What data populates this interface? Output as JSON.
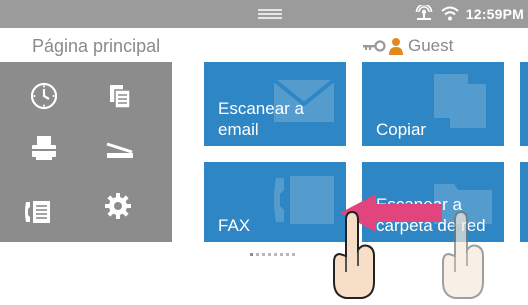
{
  "status_bar": {
    "time": "12:59PM",
    "icons": [
      "network-icon",
      "wifi-icon"
    ]
  },
  "header": {
    "page_title": "Página principal",
    "user_icons": [
      "key-icon",
      "user-icon"
    ],
    "user_label": "Guest"
  },
  "left_panel": {
    "icons": [
      "clock-icon",
      "documents-icon",
      "printer-icon",
      "scanner-icon",
      "phone-book-icon",
      "gear-icon"
    ]
  },
  "tiles": [
    {
      "label": "Escanear a email",
      "icon": "email-icon"
    },
    {
      "label": "Copiar",
      "icon": "copy-icon"
    },
    {
      "label": "FAX",
      "icon": "fax-icon"
    },
    {
      "label": "Escanear a carpeta de red",
      "icon": "network-folder-icon"
    }
  ],
  "gesture": {
    "direction": "swipe-left",
    "icons": [
      "swipe-left-arrow-icon",
      "hand-pointer-icon"
    ]
  },
  "colors": {
    "status_bar": "#9b9b9b",
    "tile": "#2f86c4",
    "left_panel": "#8c8c8c",
    "arrow": "#e2447e",
    "text_muted": "#8a8a8a"
  }
}
